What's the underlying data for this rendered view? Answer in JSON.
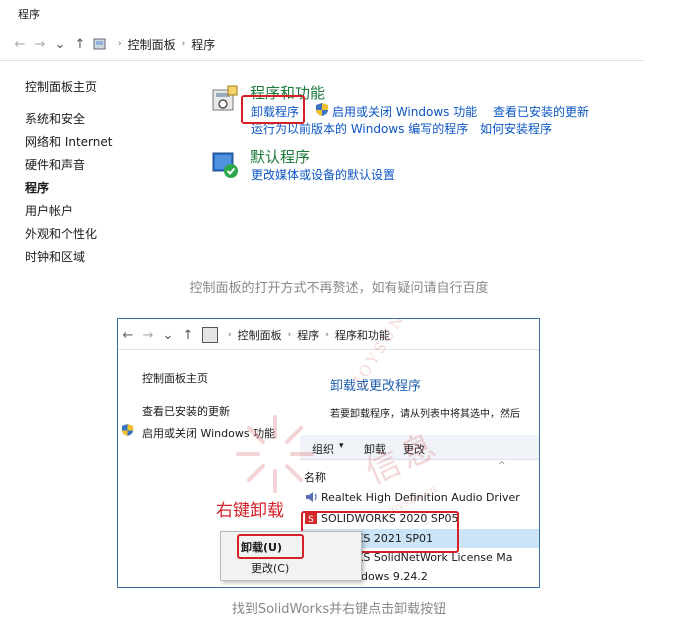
{
  "window": {
    "title": "程序"
  },
  "nav": {
    "back": "←",
    "forward": "→",
    "recent": "⌄",
    "up": "↑",
    "sep": "›",
    "breadcrumb": [
      "控制面板",
      "程序"
    ]
  },
  "sidebar": {
    "home": "控制面板主页",
    "items": [
      {
        "label": "系统和安全",
        "active": false
      },
      {
        "label": "网络和 Internet",
        "active": false
      },
      {
        "label": "硬件和声音",
        "active": false
      },
      {
        "label": "程序",
        "active": true
      },
      {
        "label": "用户帐户",
        "active": false
      },
      {
        "label": "外观和个性化",
        "active": false
      },
      {
        "label": "时钟和区域",
        "active": false
      }
    ]
  },
  "programs": {
    "title": "程序和功能",
    "links": [
      "卸载程序",
      "启用或关闭 Windows 功能",
      "查看已安装的更新",
      "运行为以前版本的 Windows 编写的程序",
      "如何安装程序"
    ]
  },
  "defaults": {
    "title": "默认程序",
    "link": "更改媒体或设备的默认设置"
  },
  "caption1": "控制面板的打开方式不再赘述，如有疑问请自行百度",
  "inner": {
    "breadcrumb": [
      "控制面板",
      "程序",
      "程序和功能"
    ],
    "sidebar_home": "控制面板主页",
    "sidebar_updates": "查看已安装的更新",
    "sidebar_features": "启用或关闭 Windows 功能",
    "heading": "卸载或更改程序",
    "instruction": "若要卸载程序，请从列表中将其选中，然后",
    "toolbar_organize": "组织",
    "toolbar_uninstall": "卸载",
    "toolbar_change": "更改",
    "col_name": "名称",
    "rows": [
      "Realtek High Definition Audio Driver",
      "SOLIDWORKS 2020 SP05",
      "WORKS 2021 SP01",
      "WORKS SolidNetWork License Ma",
      "ndows 9.24.2"
    ],
    "annotation": "右键卸载",
    "menu": [
      "卸载(U)",
      "更改(C)"
    ]
  },
  "watermark": {
    "brand": "JOYSUN",
    "chars": "信息",
    "site": "joysun.cn"
  },
  "caption2": "找到SolidWorks并右键点击卸载按钮",
  "colors": {
    "link": "#0b56c4",
    "section_title": "#1b7a3a",
    "highlight": "#d62028",
    "caption": "#888888"
  }
}
